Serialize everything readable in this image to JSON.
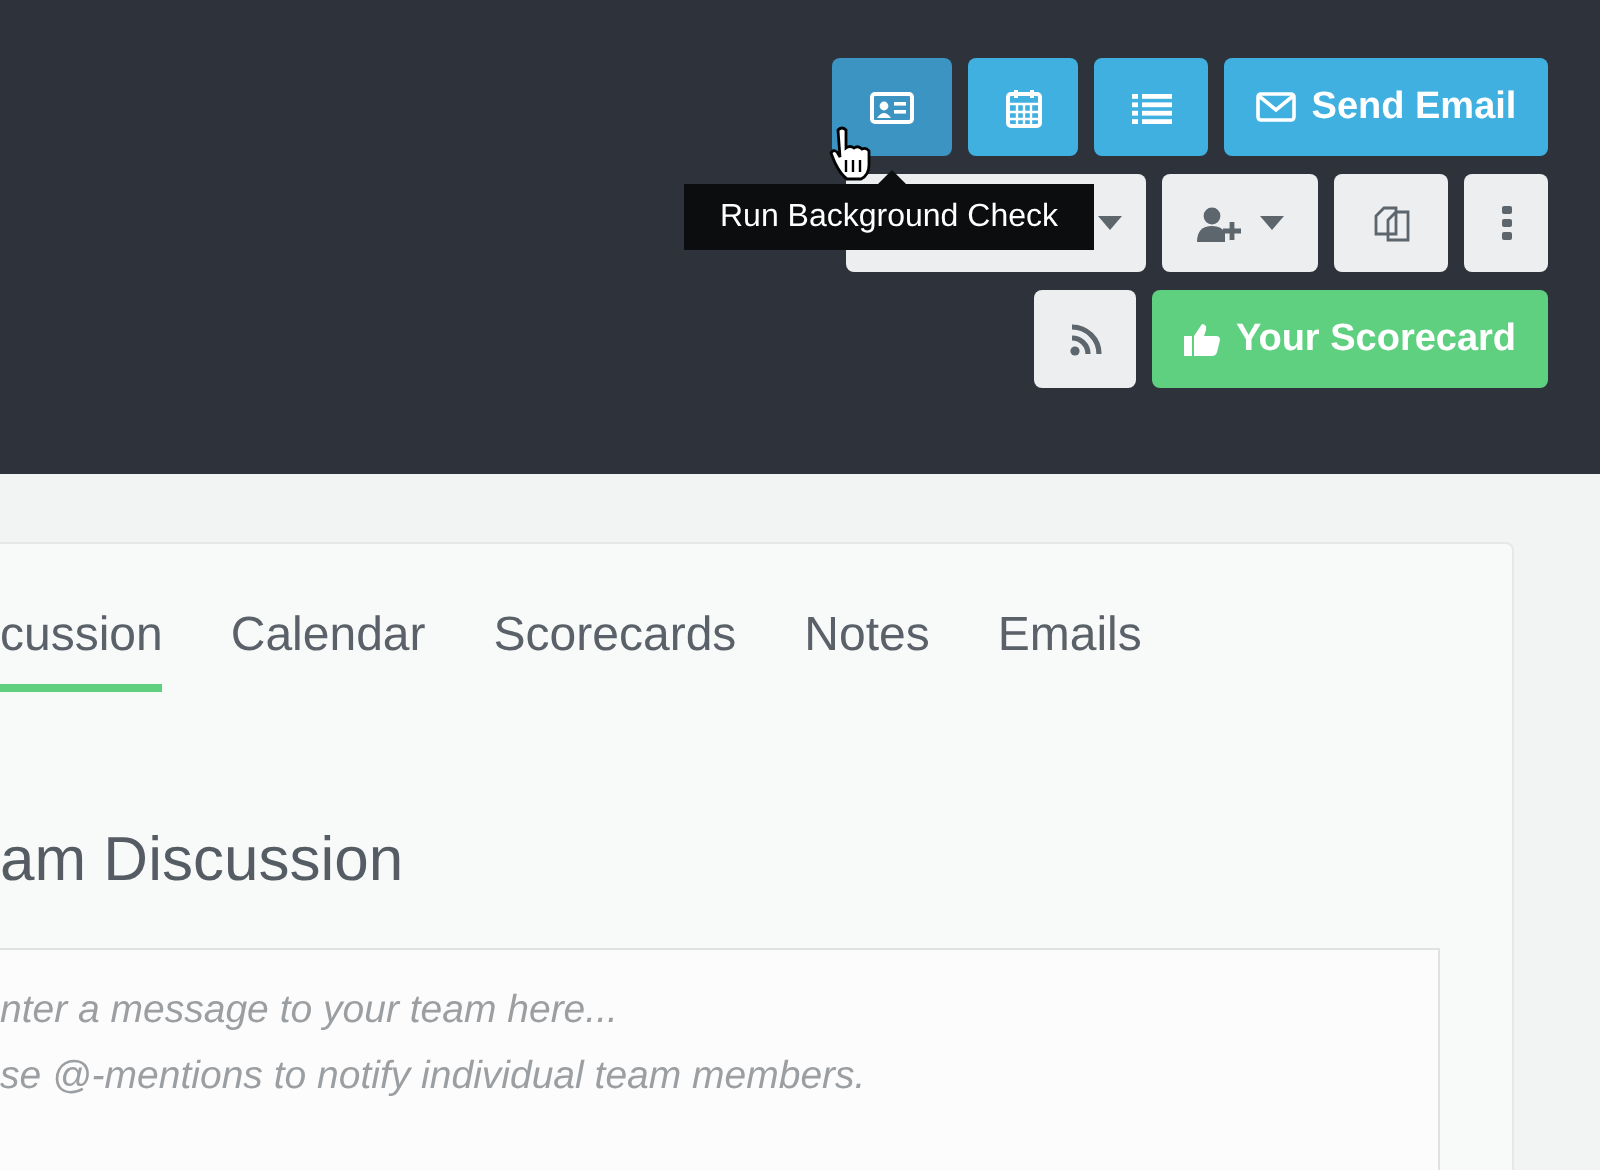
{
  "toolbar": {
    "row_1": [
      {
        "kind": "icon",
        "hovered": true
      },
      {
        "kind": "icon",
        "hovered": false
      },
      {
        "kind": "icon",
        "hovered": false
      },
      {
        "kind": "primary",
        "label": "Send Email",
        "hovered": false
      }
    ],
    "row_2": [
      {
        "kind": "dropdown"
      },
      {
        "kind": "dropdown"
      },
      {
        "kind": "icon"
      },
      {
        "kind": "icon"
      }
    ],
    "row_3": [
      {
        "kind": "icon"
      },
      {
        "kind": "success",
        "label": "Your Scorecard"
      }
    ]
  },
  "tooltip": {
    "text": "Run Background Check"
  },
  "tabs": [
    {
      "label": "cussion",
      "selected": true
    },
    {
      "label": "Calendar",
      "selected": false
    },
    {
      "label": "Scorecards",
      "selected": false
    },
    {
      "label": "Notes",
      "selected": false
    },
    {
      "label": "Emails",
      "selected": false
    }
  ],
  "heading": "am Discussion",
  "message": {
    "placeholder": "nter a message to your team here...\nse @-mentions to notify individual team members."
  }
}
